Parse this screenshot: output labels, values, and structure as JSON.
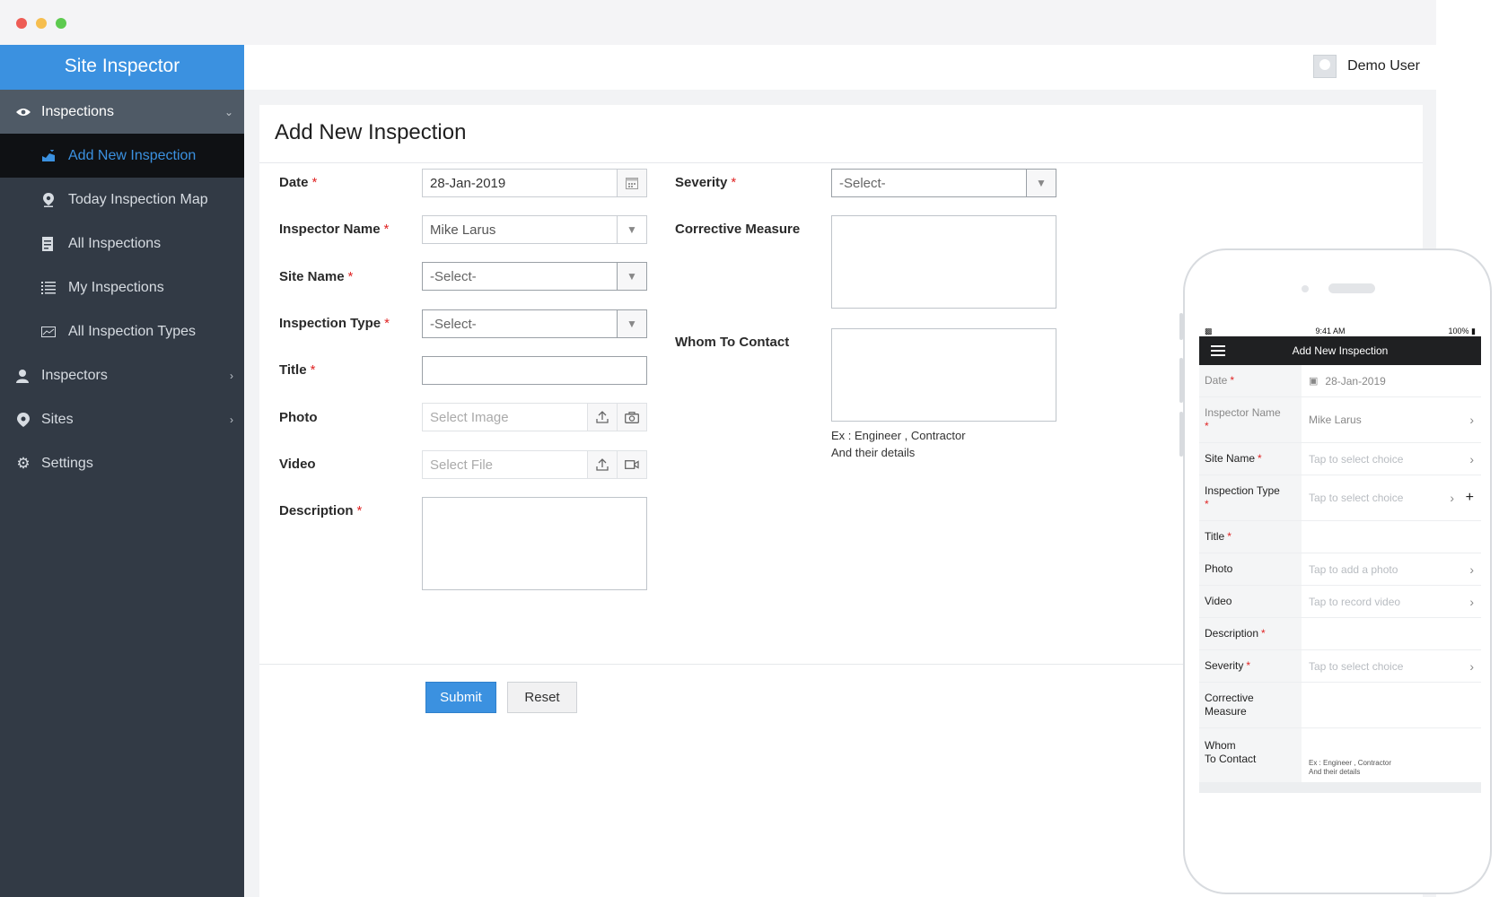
{
  "app": {
    "title": "Site Inspector"
  },
  "window": {
    "dots": [
      "#ee5c55",
      "#f6be4f",
      "#5dca4f"
    ]
  },
  "sidebar": {
    "items": [
      {
        "label": "Inspections",
        "icon": "eye-icon",
        "expanded": true
      },
      {
        "label": "Add New Inspection",
        "icon": "chart-add-icon",
        "active": true
      },
      {
        "label": "Today Inspection Map",
        "icon": "map-pin-icon"
      },
      {
        "label": "All Inspections",
        "icon": "document-list-icon"
      },
      {
        "label": "My Inspections",
        "icon": "list-icon"
      },
      {
        "label": "All Inspection Types",
        "icon": "image-chart-icon"
      },
      {
        "label": "Inspectors",
        "icon": "inspector-icon"
      },
      {
        "label": "Sites",
        "icon": "location-icon"
      },
      {
        "label": "Settings",
        "icon": "gear-icon"
      }
    ]
  },
  "topbar": {
    "user_name": "Demo User"
  },
  "form": {
    "title": "Add New Inspection",
    "required_mark": "*",
    "date": {
      "label": "Date",
      "value": "28-Jan-2019"
    },
    "inspector_name": {
      "label": "Inspector Name",
      "value": "Mike Larus"
    },
    "site_name": {
      "label": "Site Name",
      "value": "-Select-"
    },
    "inspection_type": {
      "label": "Inspection Type",
      "value": "-Select-"
    },
    "title_field": {
      "label": "Title",
      "value": ""
    },
    "photo": {
      "label": "Photo",
      "placeholder": "Select Image"
    },
    "video": {
      "label": "Video",
      "placeholder": "Select File"
    },
    "description": {
      "label": "Description"
    },
    "severity": {
      "label": "Severity",
      "value": "-Select-"
    },
    "corrective_measure": {
      "label": "Corrective Measure"
    },
    "whom_to_contact": {
      "label": "Whom To Contact",
      "hint_line1": "Ex : Engineer , Contractor",
      "hint_line2": "And their details"
    },
    "submit_label": "Submit",
    "reset_label": "Reset"
  },
  "phone": {
    "time": "9:41 AM",
    "battery": "100%",
    "header_title": "Add New Inspection",
    "rows": {
      "date": {
        "label": "Date",
        "value": "28-Jan-2019"
      },
      "inspector_name": {
        "label": "Inspector Name",
        "value": "Mike Larus"
      },
      "site_name": {
        "label": "Site Name",
        "value": "Tap to select choice"
      },
      "inspection_type": {
        "label": "Inspection Type",
        "value": "Tap to select choice"
      },
      "title": {
        "label": "Title"
      },
      "photo": {
        "label": "Photo",
        "value": "Tap to add a photo"
      },
      "video": {
        "label": "Video",
        "value": "Tap to record video"
      },
      "description": {
        "label": "Description"
      },
      "severity": {
        "label": "Severity",
        "value": "Tap to select choice"
      },
      "corrective_line1": "Corrective",
      "corrective_line2": "Measure",
      "whom_line1": "Whom",
      "whom_line2": "To Contact",
      "whom_hint1": "Ex : Engineer , Contractor",
      "whom_hint2": "And their details"
    }
  }
}
